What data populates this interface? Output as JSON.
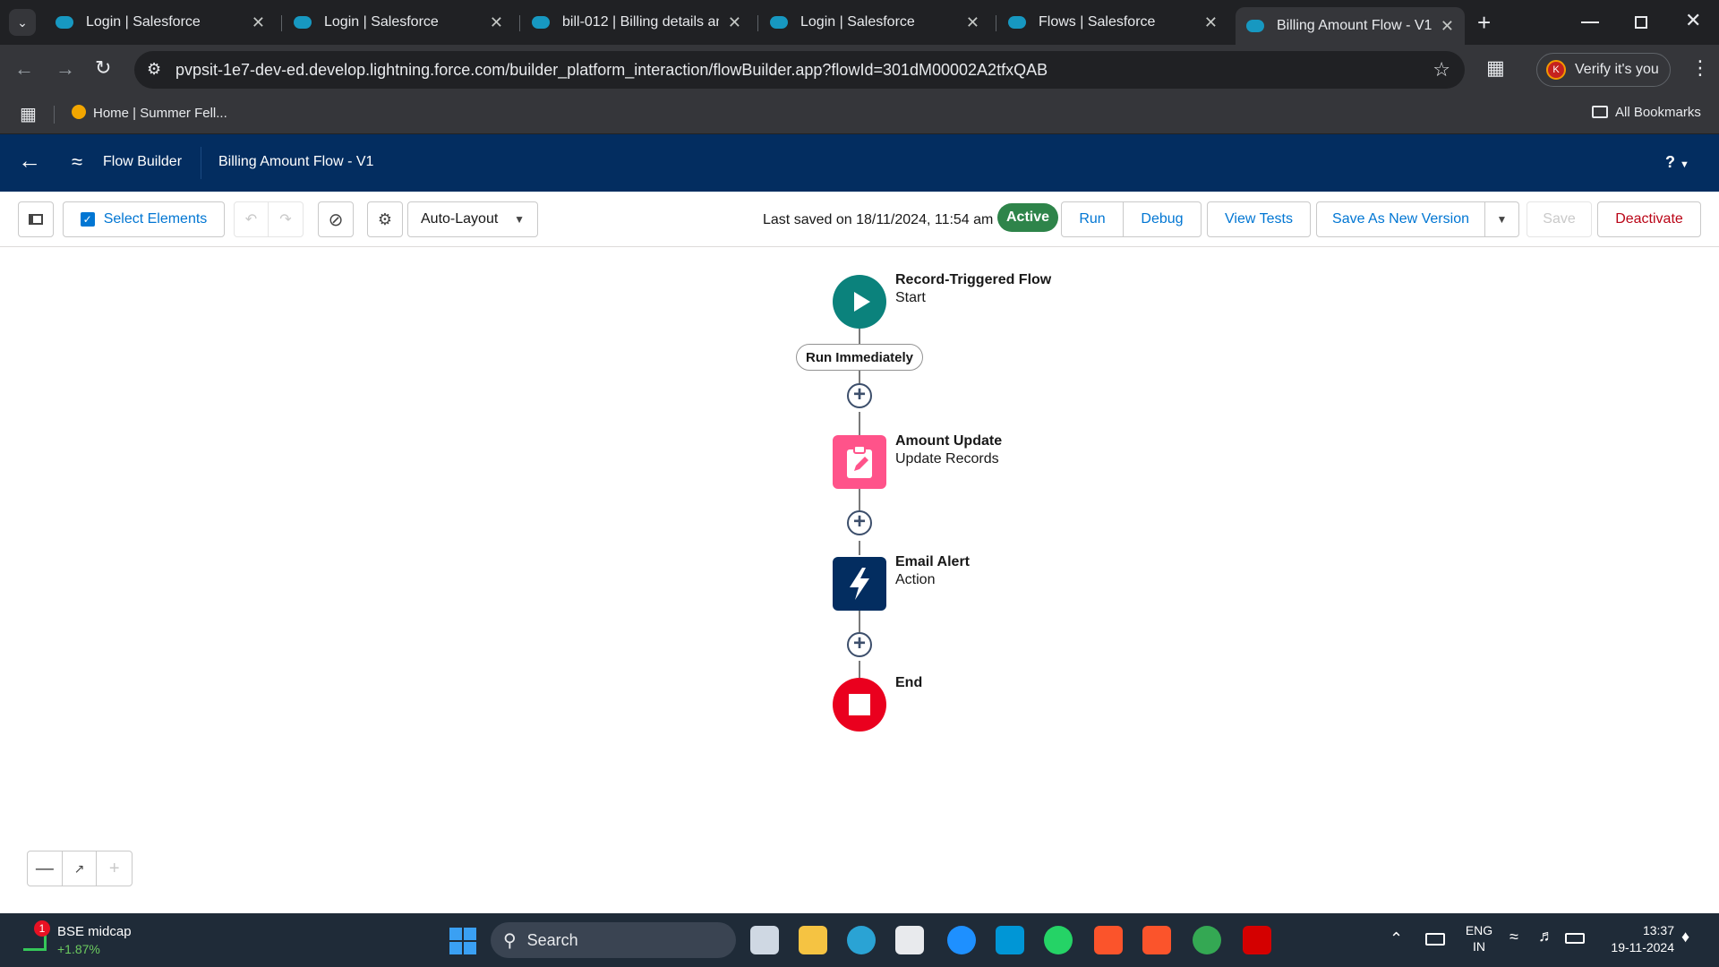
{
  "browser": {
    "tabs": [
      {
        "label": "Login | Salesforce"
      },
      {
        "label": "Login | Salesforce"
      },
      {
        "label": "bill-012 | Billing details and"
      },
      {
        "label": "Login | Salesforce"
      },
      {
        "label": "Flows | Salesforce"
      },
      {
        "label": "Billing Amount Flow - V1"
      }
    ],
    "url": "pvpsit-1e7-dev-ed.develop.lightning.force.com/builder_platform_interaction/flowBuilder.app?flowId=301dM00002A2tfxQAB",
    "verify_label": "Verify it's you",
    "avatar_letter": "K",
    "bookmark": "Home | Summer Fell...",
    "all_bookmarks": "All Bookmarks"
  },
  "header": {
    "app": "Flow Builder",
    "flow_name": "Billing Amount Flow - V1",
    "help": "?"
  },
  "toolbar": {
    "select_elements": "Select Elements",
    "layout_mode": "Auto-Layout",
    "last_saved": "Last saved on 18/11/2024, 11:54 am",
    "status": "Active",
    "run": "Run",
    "debug": "Debug",
    "view_tests": "View Tests",
    "save_as_new": "Save As New Version",
    "save": "Save",
    "deactivate": "Deactivate"
  },
  "flow": {
    "start": {
      "title": "Record-Triggered Flow",
      "subtitle": "Start"
    },
    "path_label": "Run Immediately",
    "nodes": [
      {
        "title": "Amount Update",
        "subtitle": "Update Records",
        "color": "#ff538a"
      },
      {
        "title": "Email Alert",
        "subtitle": "Action",
        "color": "#032d60"
      }
    ],
    "end": {
      "title": "End",
      "color": "#ea001e"
    },
    "start_color": "#0b827c"
  },
  "taskbar": {
    "widget_title": "BSE midcap",
    "widget_value": "+1.87%",
    "widget_badge": "1",
    "search": "Search",
    "lang": "ENG",
    "region": "IN",
    "time": "13:37",
    "date": "19-11-2024"
  }
}
